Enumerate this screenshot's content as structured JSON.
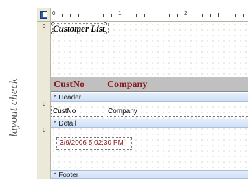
{
  "side_label": "layout check",
  "ruler": {
    "h_numbers": [
      "0",
      "1",
      "2",
      "3"
    ],
    "v_numbers": [
      "0",
      "0",
      "0"
    ]
  },
  "report": {
    "title": "Customer List",
    "columns": [
      "CustNo",
      "Company"
    ],
    "fields": [
      "CustNo",
      "Company"
    ],
    "date_value": "3/9/2006 5:02:30 PM"
  },
  "bands": {
    "header": "Header",
    "detail": "Detail",
    "footer": "Footer"
  }
}
